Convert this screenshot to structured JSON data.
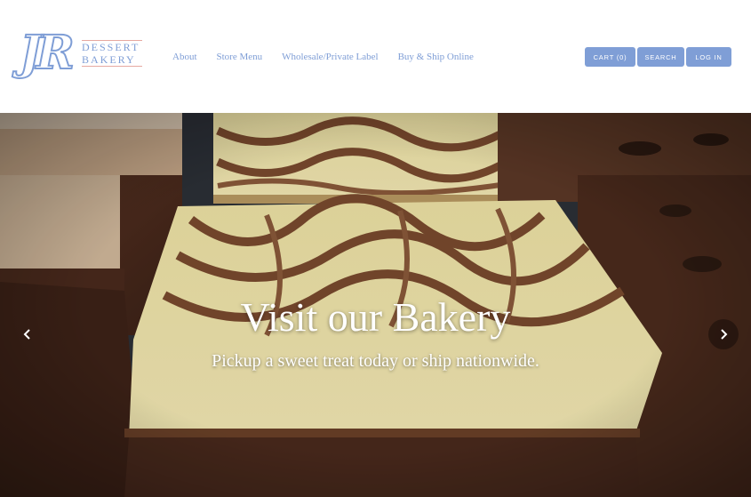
{
  "brand": {
    "mark": "JR",
    "line1": "DESSERT",
    "line2": "BAKERY",
    "accent_color": "#7f9ed6",
    "rule_color": "#e6a9a1"
  },
  "nav": {
    "items": [
      {
        "label": "About"
      },
      {
        "label": "Store Menu"
      },
      {
        "label": "Wholesale/Private Label"
      },
      {
        "label": "Buy & Ship Online"
      }
    ]
  },
  "actions": {
    "cart_label": "CART (0)",
    "search_label": "SEARCH",
    "login_label": "LOG IN",
    "button_color": "#7f9ed6"
  },
  "hero": {
    "title": "Visit our Bakery",
    "subtitle": "Pickup a sweet treat today or ship nationwide.",
    "prev_icon": "chevron-left-icon",
    "next_icon": "chevron-right-icon"
  }
}
